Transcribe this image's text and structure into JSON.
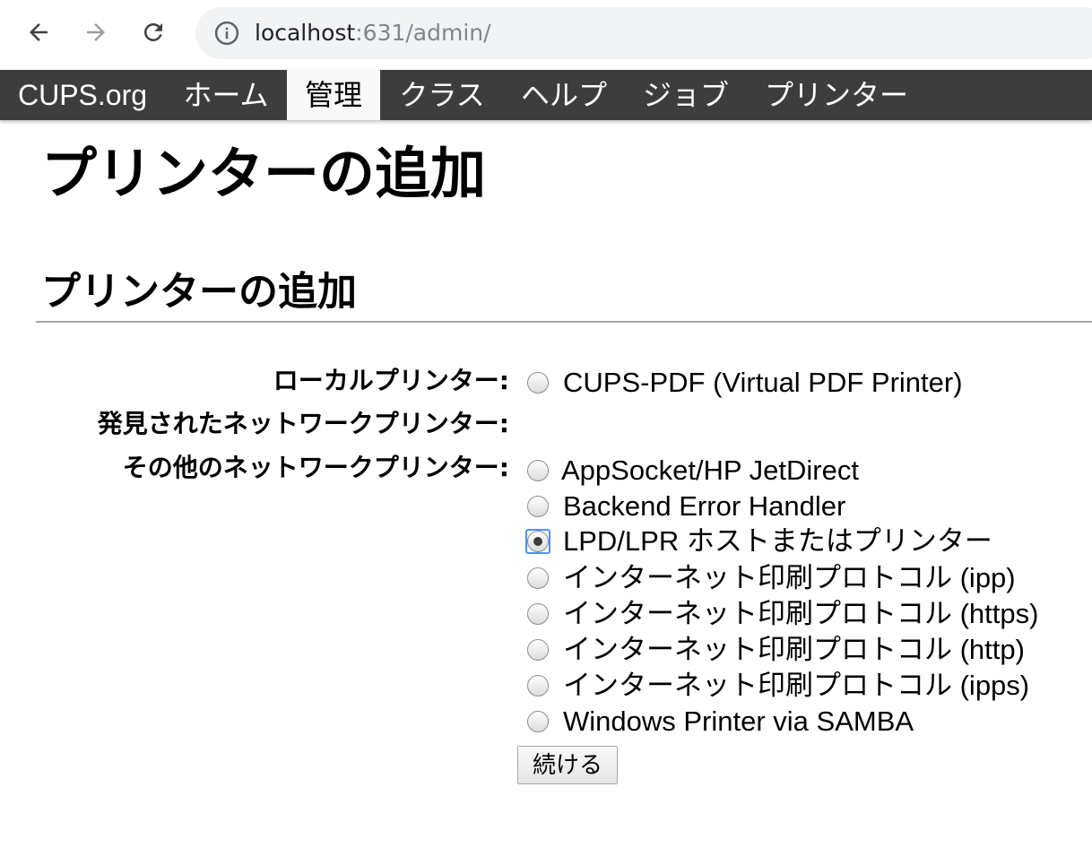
{
  "browser": {
    "back_icon": "arrow-left-icon",
    "forward_icon": "arrow-right-icon",
    "reload_icon": "reload-icon",
    "info_icon": "info-icon",
    "url_host": "localhost",
    "url_rest": ":631/admin/"
  },
  "nav": {
    "items": [
      {
        "label": "CUPS.org"
      },
      {
        "label": "ホーム"
      },
      {
        "label": "管理"
      },
      {
        "label": "クラス"
      },
      {
        "label": "ヘルプ"
      },
      {
        "label": "ジョブ"
      },
      {
        "label": "プリンター"
      }
    ],
    "active": "管理",
    "bar_color": "#3d3d3d"
  },
  "page": {
    "title": "プリンターの追加",
    "section_title": "プリンターの追加"
  },
  "form": {
    "local_label": "ローカルプリンター:",
    "discovered_label": "発見されたネットワークプリンター:",
    "other_label": "その他のネットワークプリンター:",
    "local_options": [
      {
        "label": "CUPS-PDF (Virtual PDF Printer)",
        "checked": false
      }
    ],
    "other_options": [
      {
        "label": "AppSocket/HP JetDirect",
        "checked": false
      },
      {
        "label": "Backend Error Handler",
        "checked": false
      },
      {
        "label": "LPD/LPR ホストまたはプリンター",
        "checked": true
      },
      {
        "label": "インターネット印刷プロトコル (ipp)",
        "checked": false
      },
      {
        "label": "インターネット印刷プロトコル (https)",
        "checked": false
      },
      {
        "label": "インターネット印刷プロトコル (http)",
        "checked": false
      },
      {
        "label": "インターネット印刷プロトコル (ipps)",
        "checked": false
      },
      {
        "label": "Windows Printer via SAMBA",
        "checked": false
      }
    ],
    "submit_label": "続ける",
    "focus_color": "#4d90fe"
  }
}
